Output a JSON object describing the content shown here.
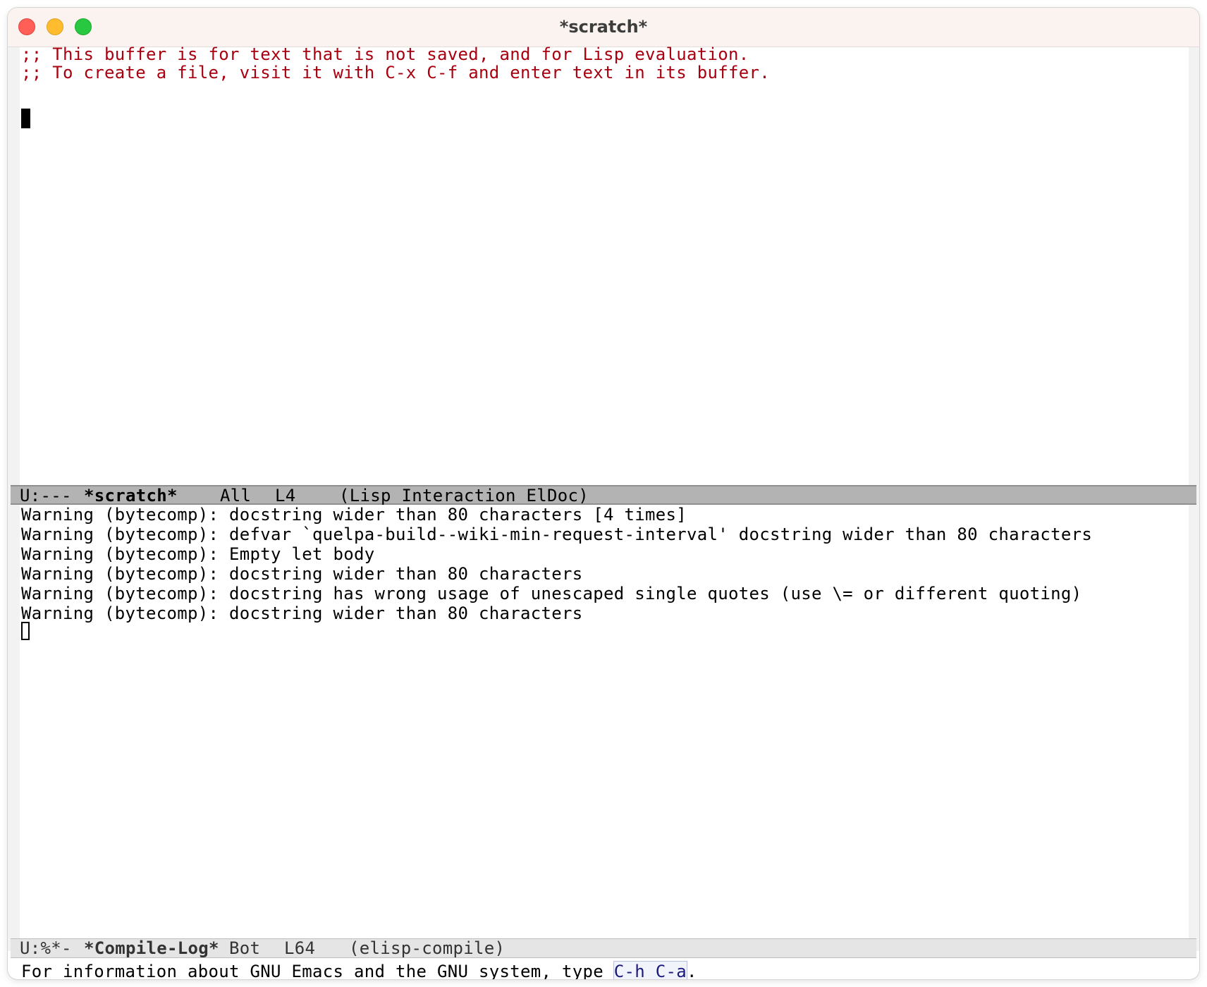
{
  "window": {
    "title": "*scratch*"
  },
  "scratch_buffer": {
    "lines": [
      ";; This buffer is for text that is not saved, and for Lisp evaluation.",
      ";; To create a file, visit it with C-x C-f and enter text in its buffer."
    ]
  },
  "scratch_modeline": {
    "status": "U:---",
    "buffer_name": "*scratch*",
    "position": "All",
    "line": "L4",
    "modes": "(Lisp Interaction ElDoc)"
  },
  "compile_log_buffer": {
    "lines": [
      "Warning (bytecomp): docstring wider than 80 characters [4 times]",
      "Warning (bytecomp): defvar `quelpa-build--wiki-min-request-interval' docstring wider than 80 characters",
      "Warning (bytecomp): Empty let body",
      "Warning (bytecomp): docstring wider than 80 characters",
      "Warning (bytecomp): docstring has wrong usage of unescaped single quotes (use \\= or different quoting)",
      "Warning (bytecomp): docstring wider than 80 characters"
    ]
  },
  "compile_log_modeline": {
    "status": "U:%*-",
    "buffer_name": "*Compile-Log*",
    "position": "Bot",
    "line": "L64",
    "modes": "(elisp-compile)"
  },
  "echo_area": {
    "prefix": "For information about GNU Emacs and the GNU system, type ",
    "keybinding": "C-h C-a",
    "suffix": "."
  },
  "colors": {
    "comment": "#a8000f",
    "titlebar": "#fbf3ef",
    "active_modeline": "#b3b3b3",
    "inactive_modeline": "#e5e5e5"
  }
}
